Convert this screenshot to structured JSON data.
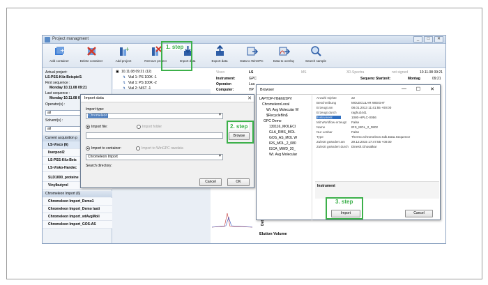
{
  "window": {
    "title": "Project managment",
    "controls": [
      "_",
      "□",
      "✕"
    ]
  },
  "toolbar": [
    {
      "label": "Add container",
      "icon": "add-container-icon",
      "color": "#3a7bd5"
    },
    {
      "label": "Delete container",
      "icon": "delete-container-icon",
      "color": "#d23a2a"
    },
    {
      "label": "Add project",
      "icon": "add-project-icon",
      "color": "#3a7bd5"
    },
    {
      "label": "Remove project",
      "icon": "remove-project-icon",
      "color": "#d23a2a"
    },
    {
      "label": "Import data",
      "icon": "import-data-icon",
      "color": "#2f5fa8"
    },
    {
      "label": "Export data",
      "icon": "export-data-icon",
      "color": "#2f5fa8"
    },
    {
      "label": "Data to WinGPC",
      "icon": "data-to-wingpc-icon",
      "color": "#2f5fa8"
    },
    {
      "label": "Data to overlay",
      "icon": "data-to-overlay-icon",
      "color": "#2f5fa8"
    },
    {
      "label": "Search sample",
      "icon": "search-sample-icon",
      "color": "#2f5fa8"
    }
  ],
  "steps": {
    "step1": "1. step",
    "step2": "2. step",
    "step3": "3. step",
    "color": "#3cb04a"
  },
  "left": {
    "actual_project_label": "Actual project:",
    "actual_project_value": "LS-PSS-Kilz-Beispiel1",
    "first_seq_label": "First sequence :",
    "first_seq_value": "Monday    10.11.08  09:21",
    "last_seq_label": "Last sequence :",
    "last_seq_value": "Monday    10.11.08  09:21",
    "operator_label": "Operator(s) :",
    "operator_value": "all",
    "solvent_label": "Solvent(s) :",
    "solvent_value": "all",
    "section1": "Current acquisition p",
    "items1": [
      "LS-Visco (6)",
      "liverpool2",
      "LS-PSS-Kilz-Beis",
      "LS-Visko-Handec",
      "SLD1000_proteine",
      "Vinylbutyrol"
    ],
    "section2": "Chromeleon Import (6)",
    "items2": [
      "Chromeleon Import_Demo1",
      "Chromeleon Import_Demo lasti",
      "Chromeleon Import_wtAvgMoli",
      "Chromeleon Import_GOS-AS"
    ]
  },
  "tree": {
    "root": "10.11.08   09:21 (12)",
    "vials": [
      "Vial  1: PS 100K -1",
      "Vial  1: PS 100K -2",
      "Vial  2: NIST -1"
    ]
  },
  "details": {
    "headers": [
      "Visco",
      "LS",
      "MS",
      "3D-Spectra",
      "not signed"
    ],
    "instrument_label": "Instrument:",
    "instrument_value": "GPC",
    "operator_label": "Operator:",
    "operator_value": "Lua",
    "computer_label": "Computer:",
    "computer_value": "HP",
    "seq_start_label": "Sequenz Startzeit:",
    "seq_start_day": "Montag",
    "seq_start_date": "10.11.08  09:21",
    "ts_date": "10.11.08",
    "ts_time": "09:21",
    "elution_label": "Elution Volume",
    "detector_label": "Detecto"
  },
  "import_dialog": {
    "title": "Import data",
    "import_type_label": "Import type:",
    "import_type_value": "Chromeleon",
    "import_file": "Import file:",
    "import_folder": "Import folder",
    "browse": "Browse",
    "import_container": "Import to container:",
    "import_wingpc": "Import to WinGPC rawdata",
    "container_value": "Chromeleon Import",
    "search_dir": "Search directory:",
    "cancel": "Cancel",
    "ok": "OK"
  },
  "browser": {
    "title": "Browser",
    "tree": [
      "LAPTOP-H6E6U5PV",
      "ChromeleonLocal",
      "Wt. Avg Molecular W",
      "$RecycleBin$",
      "GPC Demo",
      "130116_MOLECI",
      "GLA_RMS_MOL",
      "GOS_AS_MOL W",
      "IRS_MOL_2_080",
      "ISCA_MWD_20_",
      "Wt. Avg Molecular"
    ],
    "props": [
      {
        "k": "Anzahl Injekte",
        "v": "22"
      },
      {
        "k": "Beschreibung",
        "v": "MOLECULAR WEIGHT"
      },
      {
        "k": "Erzeugt am",
        "v": "08.01.2013 11:41:55 +00:00"
      },
      {
        "k": "Erzeugt durch",
        "v": "raghu2441"
      },
      {
        "k": "Instrument",
        "v": "1080-HPLC-0056"
      },
      {
        "k": "Mit Workflow erzeugt",
        "v": "False"
      },
      {
        "k": "Name",
        "v": "IRS_MOL_2_0802"
      },
      {
        "k": "Nur Lesbar",
        "v": "False"
      },
      {
        "k": "Type",
        "v": "Thermo.Chromeleon.Sdk.Data.Sequence"
      },
      {
        "k": "Zuletzt geändert am",
        "v": "29.12.2015 17:47:55 +00:00"
      },
      {
        "k": "Zuletzt geändert durch",
        "v": "Dinesh.Ghosalkar"
      }
    ],
    "desc_title": "Instrument",
    "import": "Import",
    "cancel": "Cancel"
  }
}
